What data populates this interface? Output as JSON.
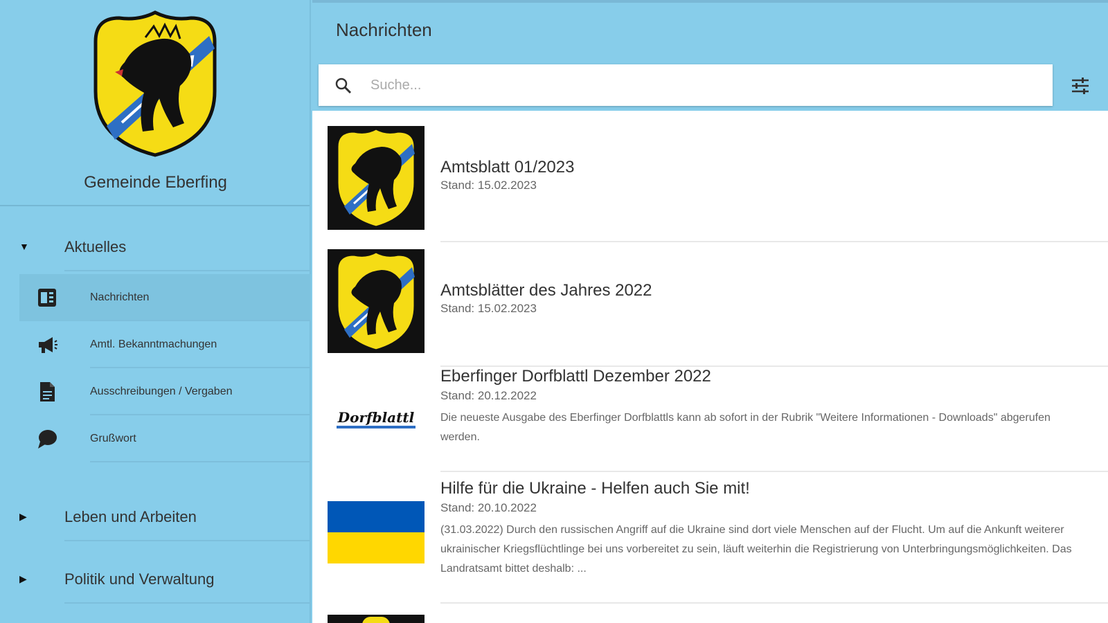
{
  "sidebar": {
    "org_name": "Gemeinde Eberfing",
    "sections": [
      {
        "label": "Aktuelles",
        "expanded": true
      },
      {
        "label": "Leben und Arbeiten",
        "expanded": false
      },
      {
        "label": "Politik und Verwaltung",
        "expanded": false
      }
    ],
    "subitems": [
      {
        "label": "Nachrichten",
        "icon": "newspaper-icon",
        "active": true
      },
      {
        "label": "Amtl. Bekanntmachungen",
        "icon": "megaphone-icon",
        "active": false
      },
      {
        "label": "Ausschreibungen / Vergaben",
        "icon": "document-icon",
        "active": false
      },
      {
        "label": "Grußwort",
        "icon": "speech-bubble-icon",
        "active": false
      }
    ]
  },
  "header": {
    "title": "Nachrichten"
  },
  "search": {
    "placeholder": "Suche..."
  },
  "news": [
    {
      "title": "Amtsblatt 01/2023",
      "date": "Stand: 15.02.2023",
      "desc": "",
      "thumb": "coat-of-arms"
    },
    {
      "title": "Amtsblätter des Jahres 2022",
      "date": "Stand: 15.02.2023",
      "desc": "",
      "thumb": "coat-of-arms"
    },
    {
      "title": "Eberfinger Dorfblattl Dezember 2022",
      "date": "Stand: 20.12.2022",
      "desc": "Die neueste Ausgabe des Eberfinger Dorfblattls kann ab sofort in der Rubrik \"Weitere Informationen - Downloads\" abgerufen werden.",
      "thumb": "dorfblattl-logo",
      "thumb_text": "Dorfblattl"
    },
    {
      "title": "Hilfe für die Ukraine - Helfen auch Sie mit!",
      "date": "Stand: 20.10.2022",
      "desc": "(31.03.2022) Durch den russischen Angriff auf die Ukraine sind dort viele Menschen auf der Flucht. Um auf die Ankunft weiterer ukrainischer Kriegsflüchtlinge bei uns vorbereitet zu sein, läuft weiterhin die Registrierung von Unterbringungsmöglichkeiten. Das Landratsamt bittet deshalb: ...",
      "thumb": "ukraine-flag"
    }
  ],
  "colors": {
    "background": "#87cdea",
    "coat_yellow": "#f5dc15",
    "coat_blue": "#2e6fc4",
    "ukraine_blue": "#0057b7",
    "ukraine_yellow": "#ffd700"
  }
}
